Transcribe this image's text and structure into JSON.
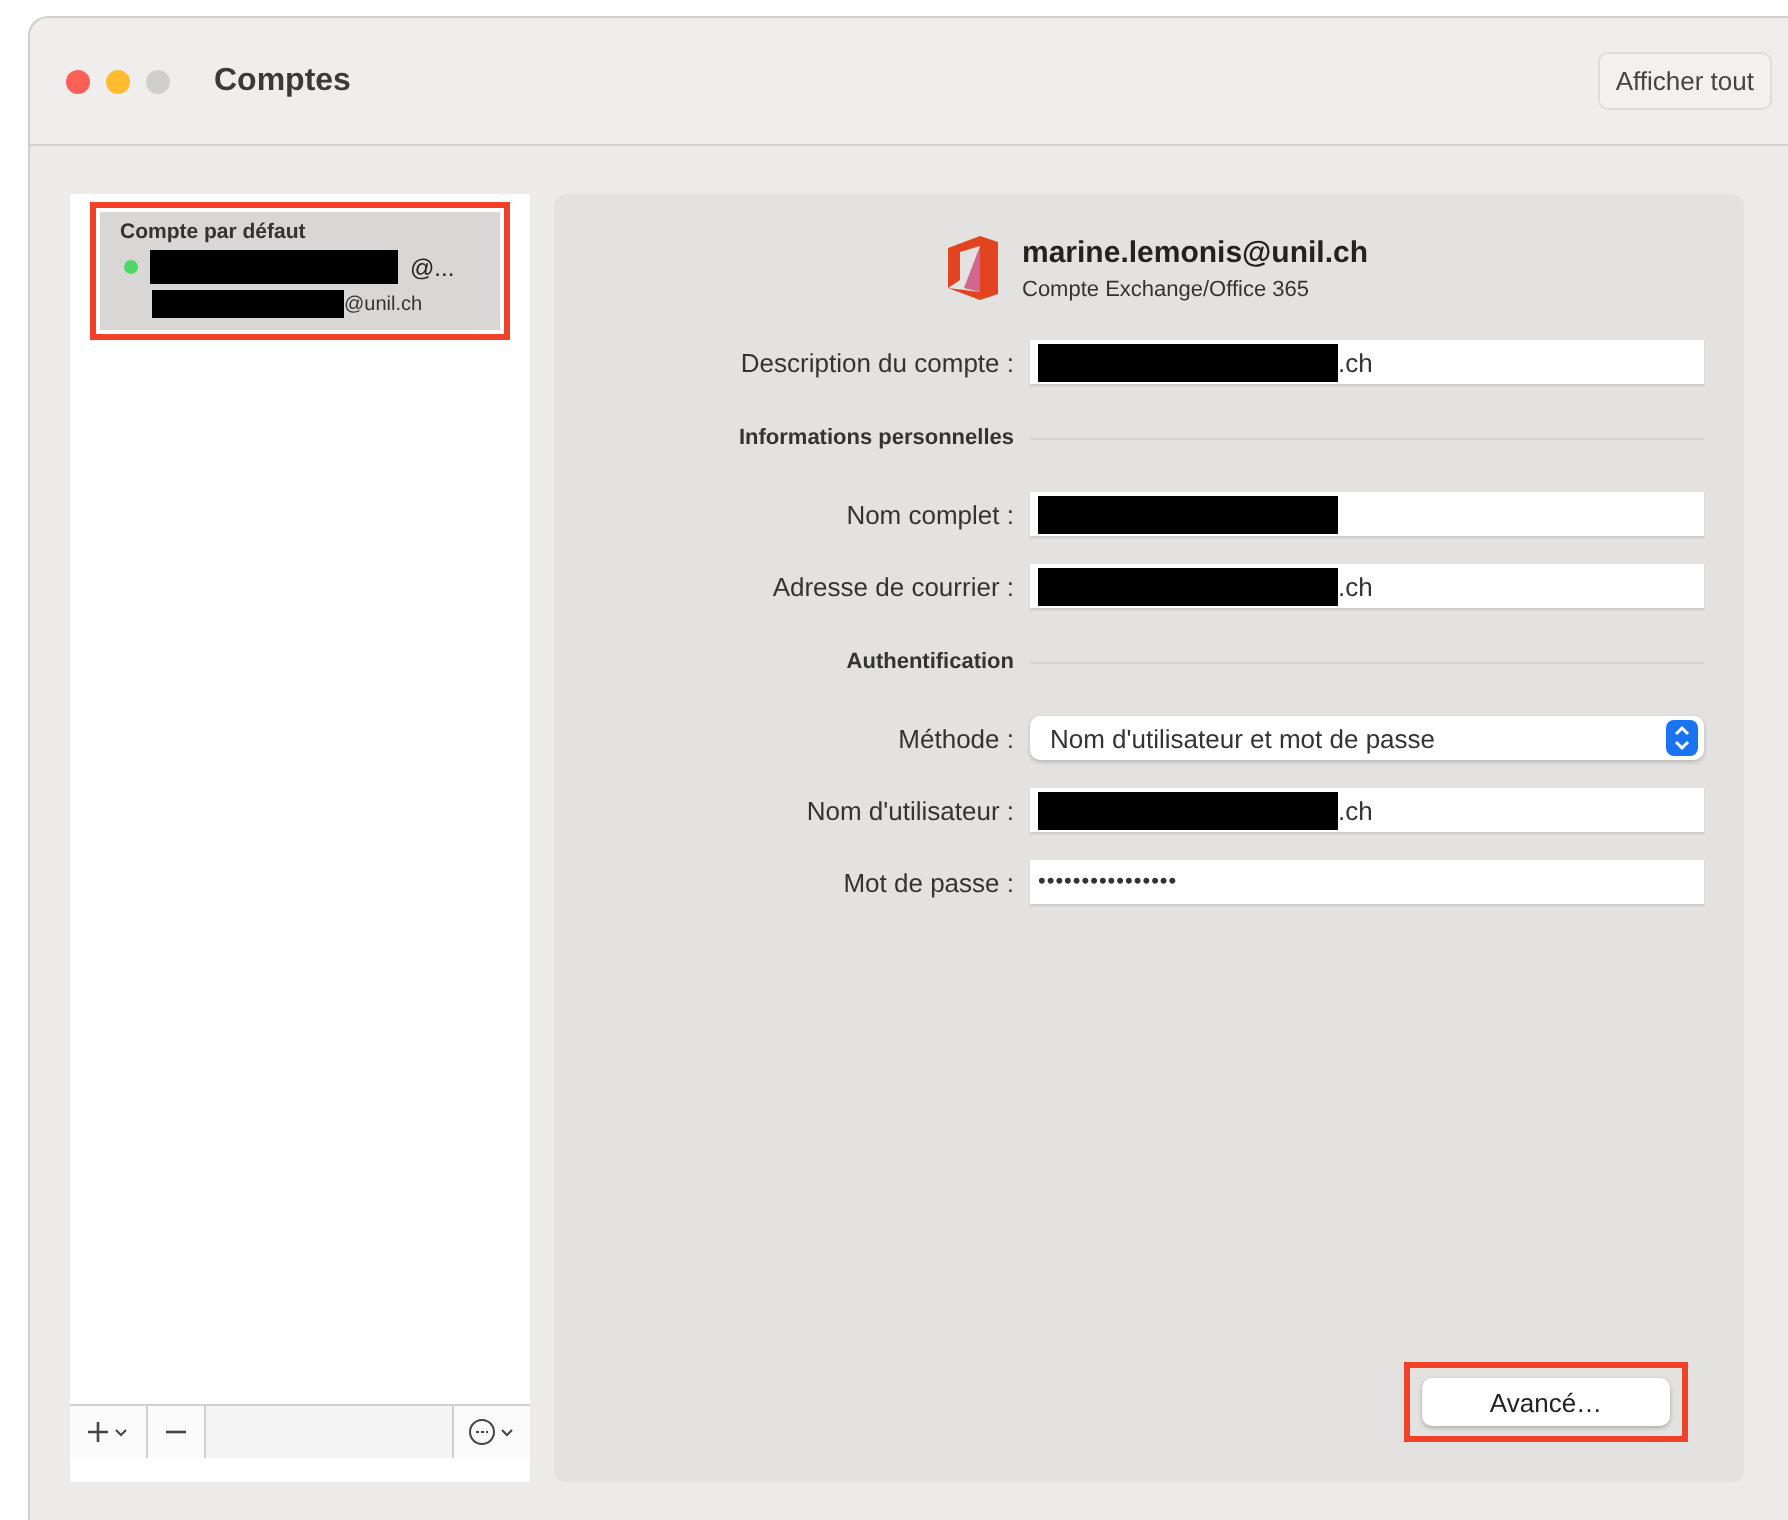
{
  "window": {
    "title": "Comptes",
    "toolbar_button": "Afficher tout"
  },
  "sidebar": {
    "section_label": "Compte par défaut",
    "highlighted": true,
    "accounts": [
      {
        "line_1": "@...",
        "line_2": "@unil.ch",
        "color": "#4cd964",
        "selected": true
      }
    ]
  },
  "account_header": {
    "email": "marine.lemonis@unil.ch",
    "type": "Compte Exchange/Office 365"
  },
  "form": [
    {
      "kind": "field",
      "label": "Description du compte :",
      "value": ".ch",
      "redacted": true
    },
    {
      "kind": "heading",
      "label": "Informations personnelles"
    },
    {
      "kind": "field",
      "label": "Nom complet :",
      "redacted": true
    },
    {
      "kind": "field",
      "label": "Adresse de courrier :",
      "value": ".ch",
      "redacted": true
    },
    {
      "kind": "heading",
      "label": "Authentification"
    },
    {
      "kind": "select",
      "label": "Méthode :",
      "value": "Nom d'utilisateur et mot de passe"
    },
    {
      "kind": "field",
      "label": "Nom d'utilisateur :",
      "value": ".ch",
      "redacted": true
    },
    {
      "kind": "password",
      "label": "Mot de passe :",
      "value": "••••••••••••••••"
    }
  ],
  "advanced_button": {
    "label": "Avancé…",
    "highlighted": true
  }
}
